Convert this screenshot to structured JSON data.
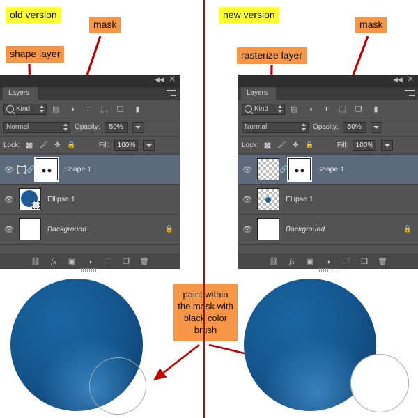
{
  "callouts": {
    "old_version": "old version",
    "new_version": "new version",
    "mask_left": "mask",
    "mask_right": "mask",
    "shape_layer": "shape layer",
    "rasterize_layer": "rasterize layer",
    "paint_note": "paint within the mask with black color brush"
  },
  "colors": {
    "highlight_yellow": "#ffff33",
    "callout_orange": "#f79646",
    "arrow_red": "#c00000",
    "divider_red": "#8b1a1a",
    "panel_bg": "#535353",
    "panel_titlebar": "#2f2f2f",
    "layer_selected": "#5c6a7c",
    "circle_blue": "#15578f",
    "circle_blue_dark": "#0d3f6b",
    "circle_blue_light": "#2f7cbe"
  },
  "panel_left": {
    "tab_label": "Layers",
    "titlebar": {
      "collapse_icon": "collapse-icon",
      "close_icon": "close-icon",
      "menu_icon": "panel-menu-icon"
    },
    "filter": {
      "kind_label": "Kind",
      "search_icon": "search-icon",
      "icons": [
        "pixel-filter-icon",
        "adjustment-filter-icon",
        "type-filter-icon",
        "shape-filter-icon",
        "smart-object-filter-icon",
        "filter-toggle-icon"
      ]
    },
    "blend": {
      "mode": "Normal",
      "opacity_label": "Opacity:",
      "opacity_value": "50%"
    },
    "lock": {
      "label": "Lock:",
      "icons": [
        "lock-transparent-pixels-icon",
        "lock-image-pixels-icon",
        "lock-position-icon",
        "lock-all-icon"
      ],
      "fill_label": "Fill:",
      "fill_value": "100%"
    },
    "layers": [
      {
        "name": "Shape 1",
        "selected": true,
        "visible": true,
        "locked": false,
        "italic": false,
        "thumb_type": "vector",
        "has_link": true,
        "has_mask": true,
        "mask_selected": true
      },
      {
        "name": "Ellipse 1",
        "selected": false,
        "visible": true,
        "locked": false,
        "italic": false,
        "thumb_type": "ellipse-vector",
        "has_link": false,
        "has_mask": false,
        "mask_selected": false
      },
      {
        "name": "Background",
        "selected": false,
        "visible": true,
        "locked": true,
        "italic": true,
        "thumb_type": "white",
        "has_link": false,
        "has_mask": false,
        "mask_selected": false
      }
    ],
    "bottom_icons": [
      "link-layers-icon",
      "layer-style-fx-icon",
      "add-layer-mask-icon",
      "adjustment-layer-icon",
      "new-group-icon",
      "new-layer-icon",
      "delete-layer-icon"
    ]
  },
  "panel_right": {
    "tab_label": "Layers",
    "titlebar": {
      "collapse_icon": "collapse-icon",
      "close_icon": "close-icon",
      "menu_icon": "panel-menu-icon"
    },
    "filter": {
      "kind_label": "Kind",
      "search_icon": "search-icon",
      "icons": [
        "pixel-filter-icon",
        "adjustment-filter-icon",
        "type-filter-icon",
        "shape-filter-icon",
        "smart-object-filter-icon",
        "filter-toggle-icon"
      ]
    },
    "blend": {
      "mode": "Normal",
      "opacity_label": "Opacity:",
      "opacity_value": "50%"
    },
    "lock": {
      "label": "Lock:",
      "icons": [
        "lock-transparent-pixels-icon",
        "lock-image-pixels-icon",
        "lock-position-icon",
        "lock-all-icon"
      ],
      "fill_label": "Fill:",
      "fill_value": "100%"
    },
    "layers": [
      {
        "name": "Shape 1",
        "selected": true,
        "visible": true,
        "locked": false,
        "italic": false,
        "thumb_type": "raster",
        "has_link": true,
        "has_mask": true,
        "mask_selected": true
      },
      {
        "name": "Ellipse 1",
        "selected": false,
        "visible": true,
        "locked": false,
        "italic": false,
        "thumb_type": "raster-dot",
        "has_link": false,
        "has_mask": false,
        "mask_selected": false
      },
      {
        "name": "Background",
        "selected": false,
        "visible": true,
        "locked": true,
        "italic": true,
        "thumb_type": "white",
        "has_link": false,
        "has_mask": false,
        "mask_selected": false
      }
    ],
    "bottom_icons": [
      "link-layers-icon",
      "layer-style-fx-icon",
      "add-layer-mask-icon",
      "adjustment-layer-icon",
      "new-group-icon",
      "new-layer-icon",
      "delete-layer-icon"
    ]
  },
  "artwork": {
    "left_circle_label": "blue-circle-unmasked",
    "right_circle_label": "blue-circle-masked",
    "brush_cursor_label": "brush-cursor-outline"
  }
}
